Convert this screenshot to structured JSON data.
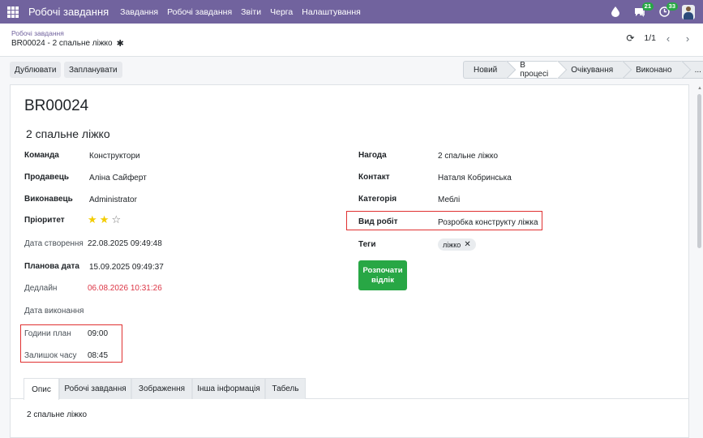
{
  "navbar": {
    "brand": "Робочі завдання",
    "menu": [
      "Завдання",
      "Робочі завдання",
      "Звіти",
      "Черга",
      "Налаштування"
    ],
    "chat_count": "21",
    "activity_count": "33"
  },
  "breadcrumb": {
    "parent": "Робочі завдання",
    "current": "BR00024 - 2 спальне ліжко"
  },
  "pager": {
    "value": "1/1"
  },
  "actions": {
    "duplicate": "Дублювати",
    "schedule": "Запланувати"
  },
  "stages": [
    "Новий",
    "В процесі",
    "Очікування",
    "Виконано",
    "..."
  ],
  "active_stage": "В процесі",
  "record": {
    "code": "BR00024",
    "name": "2 спальне ліжко"
  },
  "left_fields": {
    "team_label": "Команда",
    "team": "Конструктори",
    "seller_label": "Продавець",
    "seller": "Аліна Сайферт",
    "executor_label": "Виконавець",
    "executor": "Administrator",
    "priority_label": "Пріоритет",
    "priority_stars": 2,
    "priority_max": 3,
    "created_label": "Дата створення",
    "created": "22.08.2025 09:49:48",
    "planned_label": "Планова дата",
    "planned": "15.09.2025 09:49:37",
    "deadline_label": "Дедлайн",
    "deadline": "06.08.2026 10:31:26",
    "done_label": "Дата виконання",
    "hours_plan_label": "Години план",
    "hours_plan": "09:00",
    "remaining_label": "Залишок часу",
    "remaining": "08:45"
  },
  "right_fields": {
    "opportunity_label": "Нагода",
    "opportunity": "2 спальне ліжко",
    "contact_label": "Контакт",
    "contact": "Наталя Кобринська",
    "category_label": "Категорія",
    "category": "Меблі",
    "work_type_label": "Вид робіт",
    "work_type": "Розробка конструкту ліжка",
    "tags_label": "Теги",
    "tag": "ліжко"
  },
  "start_button": "Розпочати відлік",
  "tabs": [
    "Опис",
    "Робочі завдання",
    "Зображення",
    "Інша інформація",
    "Табель"
  ],
  "active_tab": "Опис",
  "description": "2 спальне ліжко",
  "colors": {
    "navbar": "#71639e",
    "accent_green": "#28a745",
    "deadline_red": "#dc3545",
    "highlight_red": "#e03131"
  }
}
